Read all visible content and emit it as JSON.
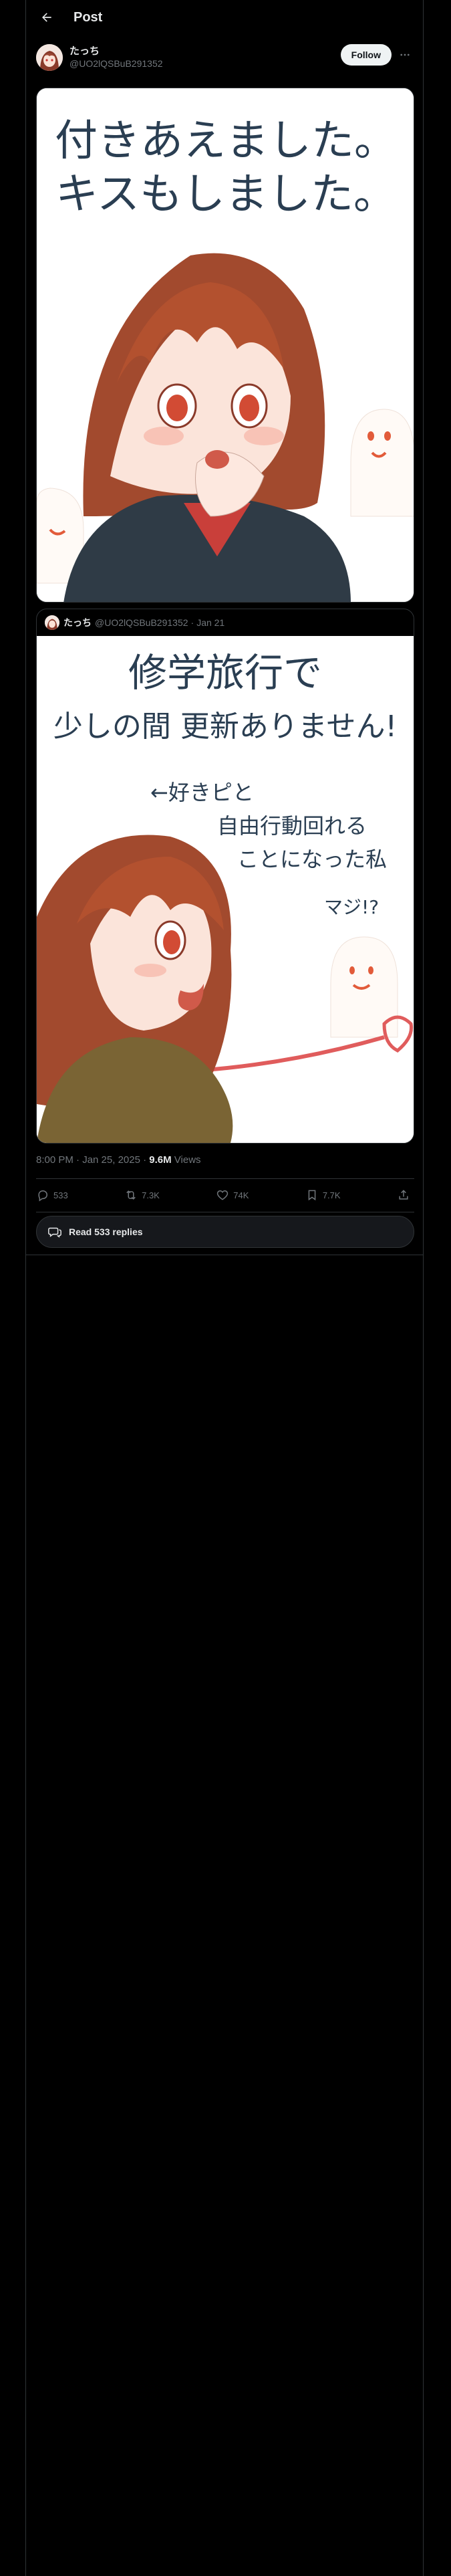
{
  "header": {
    "title": "Post"
  },
  "author": {
    "display_name": "たっち",
    "handle": "@UO2lQSBuB291352",
    "follow_label": "Follow"
  },
  "image1": {
    "line1": "付きあえました。",
    "line2": "キスもしました。"
  },
  "quote": {
    "display_name": "たっち",
    "handle": "@UO2lQSBuB291352",
    "separator": "·",
    "date": "Jan 21",
    "image": {
      "line1": "修学旅行で",
      "line2": "少しの間 更新ありません!",
      "note1": "←好きピと",
      "note2": "自由行動回れる",
      "note3": "ことになった私",
      "note4": "マジ!?"
    }
  },
  "meta": {
    "timestamp": "8:00 PM · Jan 25, 2025 · ",
    "views_count": "9.6M",
    "views_label": " Views"
  },
  "actions": {
    "replies": "533",
    "reposts": "7.3K",
    "likes": "74K",
    "bookmarks": "7.7K"
  },
  "read_replies": "Read 533 replies",
  "colors": {
    "background": "#000000",
    "text": "#e7e9ea",
    "muted": "#71767b",
    "border": "#2f3336",
    "follow_bg": "#eff3f4"
  }
}
